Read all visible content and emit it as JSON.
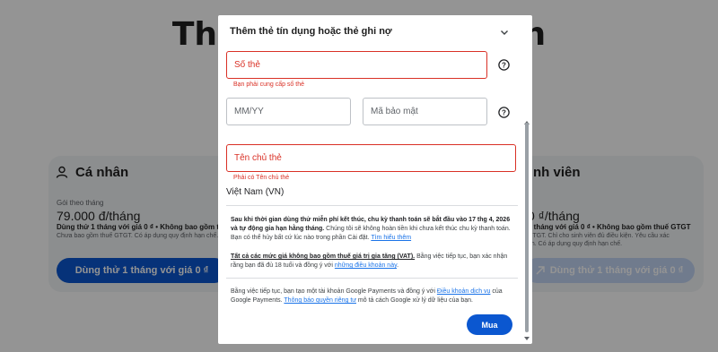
{
  "background": {
    "title": "Tham gia thành viên",
    "cards": [
      {
        "name": "Cá nhân",
        "period_label": "Gói theo tháng",
        "price": "79.000 đ/tháng",
        "trial_line": "Dùng thử 1 tháng với giá 0 ₫ • Không bao gồm thuế GTGT",
        "fine_print": "Chưa bao gồm thuế GTGT. Có áp dụng quy định hạn chế.",
        "cta": "Dùng thử 1 tháng với giá 0 ₫"
      },
      {
        "name": "nh viên",
        "price": "0 ₫/tháng",
        "trial_line": "1 tháng với giá 0 ₫ • Không bao gồm thuế GTGT",
        "fine_print_a": "GTGT. Chỉ cho sinh viên đủ điều kiện. Yêu cầu xác",
        "fine_print_b": "nh. Có áp dụng quy định hạn chế.",
        "cta": "Dùng thử 1 tháng với giá 0 ₫"
      }
    ]
  },
  "dialog": {
    "title": "Thêm thẻ tín dụng hoặc thẻ ghi nợ",
    "card_number": {
      "placeholder": "Số thẻ",
      "error": "Bạn phải cung cấp số thẻ"
    },
    "expiry": {
      "placeholder": "MM/YY"
    },
    "cvc": {
      "placeholder": "Mã bảo mật"
    },
    "holder": {
      "placeholder": "Tên chủ thẻ",
      "error": "Phải có Tên chủ thẻ"
    },
    "country": "Việt Nam (VN)",
    "terms_1_bold": "Sau khi thời gian dùng thử miễn phí kết thúc, chu kỳ thanh toán sẽ bắt đầu vào 17 thg 4, 2026 và tự động gia hạn hằng tháng.",
    "terms_1_text": " Chúng tôi sẽ không hoàn tiền khi chưa kết thúc chu kỳ thanh toán. Bạn có thể hủy bất cứ lúc nào trong phần Cài đặt. ",
    "terms_1_link": "Tìm hiểu thêm",
    "terms_2_bold": "Tất cả các mức giá không bao gồm thuế giá trị gia tăng (VAT).",
    "terms_2_text": " Bằng việc tiếp tục, bạn xác nhận rằng bạn đã đủ 18 tuổi và đồng ý với ",
    "terms_2_link": "những điều khoản này",
    "terms_2_end": ".",
    "terms_3_text": "Bằng việc tiếp tục, bạn tạo một tài khoản Google Payments và đồng ý với ",
    "terms_3_link1": "Điều khoản dịch vụ",
    "terms_3_mid": " của Google Payments. ",
    "terms_3_link2": "Thông báo quyền riêng tư",
    "terms_3_end": " mô tả cách Google xử lý dữ liệu của bạn.",
    "buy_button": "Mua"
  },
  "colors": {
    "primary": "#0b57d0",
    "error": "#d93025",
    "link": "#1a73e8",
    "overlay": "rgba(0,0,0,0.42)"
  },
  "icons": [
    "person-icon",
    "chevron-down-icon",
    "help-icon",
    "arrow-icon"
  ]
}
